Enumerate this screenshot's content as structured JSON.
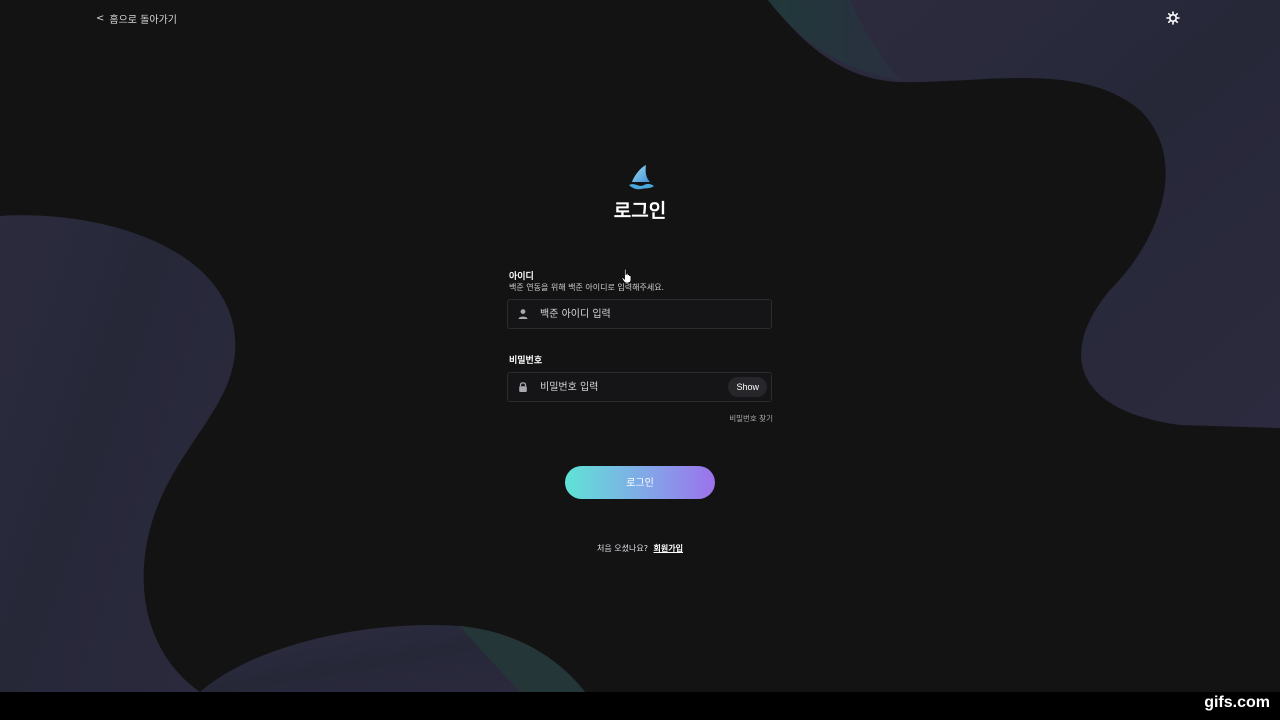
{
  "header": {
    "back_chevron": "<",
    "back_label": "홈으로 돌아가기",
    "theme_icon": "gear-icon"
  },
  "login": {
    "title": "로그인",
    "id_label": "아이디",
    "id_hint": "백준 연동을 위해 백준 아이디로 입력해주세요.",
    "id_placeholder": "백준 아이디 입력",
    "password_label": "비밀번호",
    "password_placeholder": "비밀번호 입력",
    "show_label": "Show",
    "forgot_label": "비밀번호 찾기",
    "submit_label": "로그인",
    "signup_prompt": "처음 오셨나요?",
    "signup_link": "회원가입"
  },
  "colors": {
    "background": "#131314",
    "blob": "#2a2a3c",
    "button_gradient_start": "#5fe3d6",
    "button_gradient_end": "#9c72ec"
  },
  "watermark": "gifs.com"
}
